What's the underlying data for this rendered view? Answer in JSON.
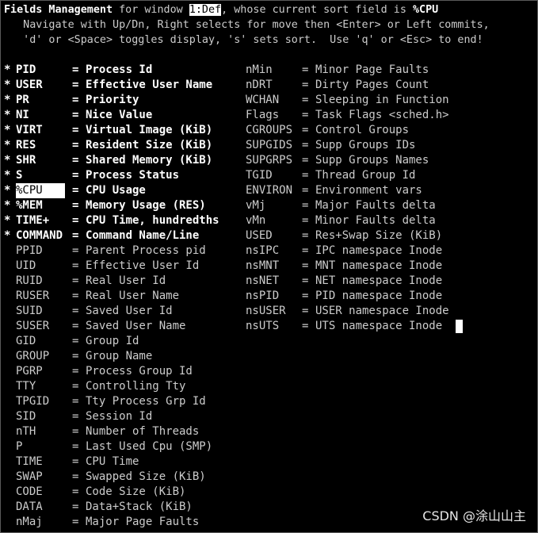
{
  "header": {
    "line1_part1": "Fields Management",
    "line1_part2": " for window ",
    "line1_window": "1:Def",
    "line1_part3": ", whose current sort field is ",
    "line1_sort": "%CPU",
    "line2": "   Navigate with Up/Dn, Right selects for move then <Enter> or Left commits,",
    "line3": "   'd' or <Space> toggles display, 's' sets sort.  Use 'q' or <Esc> to end!"
  },
  "left_fields": [
    {
      "mark": "*",
      "name": "PID",
      "eq": "=",
      "desc": "Process Id",
      "on": true
    },
    {
      "mark": "*",
      "name": "USER",
      "eq": "=",
      "desc": "Effective User Name",
      "on": true
    },
    {
      "mark": "*",
      "name": "PR",
      "eq": "=",
      "desc": "Priority",
      "on": true
    },
    {
      "mark": "*",
      "name": "NI",
      "eq": "=",
      "desc": "Nice Value",
      "on": true
    },
    {
      "mark": "*",
      "name": "VIRT",
      "eq": "=",
      "desc": "Virtual Image (KiB)",
      "on": true
    },
    {
      "mark": "*",
      "name": "RES",
      "eq": "=",
      "desc": "Resident Size (KiB)",
      "on": true
    },
    {
      "mark": "*",
      "name": "SHR",
      "eq": "=",
      "desc": "Shared Memory (KiB)",
      "on": true
    },
    {
      "mark": "*",
      "name": "S",
      "eq": "=",
      "desc": "Process Status",
      "on": true
    },
    {
      "mark": "*",
      "name": "%CPU",
      "eq": "=",
      "desc": "CPU Usage",
      "on": true,
      "selected": true
    },
    {
      "mark": "*",
      "name": "%MEM",
      "eq": "=",
      "desc": "Memory Usage (RES)",
      "on": true
    },
    {
      "mark": "*",
      "name": "TIME+",
      "eq": "=",
      "desc": "CPU Time, hundredths",
      "on": true
    },
    {
      "mark": "*",
      "name": "COMMAND",
      "eq": "=",
      "desc": "Command Name/Line",
      "on": true
    },
    {
      "mark": "",
      "name": "PPID",
      "eq": "=",
      "desc": "Parent Process pid",
      "on": false
    },
    {
      "mark": "",
      "name": "UID",
      "eq": "=",
      "desc": "Effective User Id",
      "on": false
    },
    {
      "mark": "",
      "name": "RUID",
      "eq": "=",
      "desc": "Real User Id",
      "on": false
    },
    {
      "mark": "",
      "name": "RUSER",
      "eq": "=",
      "desc": "Real User Name",
      "on": false
    },
    {
      "mark": "",
      "name": "SUID",
      "eq": "=",
      "desc": "Saved User Id",
      "on": false
    },
    {
      "mark": "",
      "name": "SUSER",
      "eq": "=",
      "desc": "Saved User Name",
      "on": false
    },
    {
      "mark": "",
      "name": "GID",
      "eq": "=",
      "desc": "Group Id",
      "on": false
    },
    {
      "mark": "",
      "name": "GROUP",
      "eq": "=",
      "desc": "Group Name",
      "on": false
    },
    {
      "mark": "",
      "name": "PGRP",
      "eq": "=",
      "desc": "Process Group Id",
      "on": false
    },
    {
      "mark": "",
      "name": "TTY",
      "eq": "=",
      "desc": "Controlling Tty",
      "on": false
    },
    {
      "mark": "",
      "name": "TPGID",
      "eq": "=",
      "desc": "Tty Process Grp Id",
      "on": false
    },
    {
      "mark": "",
      "name": "SID",
      "eq": "=",
      "desc": "Session Id",
      "on": false
    },
    {
      "mark": "",
      "name": "nTH",
      "eq": "=",
      "desc": "Number of Threads",
      "on": false
    },
    {
      "mark": "",
      "name": "P",
      "eq": "=",
      "desc": "Last Used Cpu (SMP)",
      "on": false
    },
    {
      "mark": "",
      "name": "TIME",
      "eq": "=",
      "desc": "CPU Time",
      "on": false
    },
    {
      "mark": "",
      "name": "SWAP",
      "eq": "=",
      "desc": "Swapped Size (KiB)",
      "on": false
    },
    {
      "mark": "",
      "name": "CODE",
      "eq": "=",
      "desc": "Code Size (KiB)",
      "on": false
    },
    {
      "mark": "",
      "name": "DATA",
      "eq": "=",
      "desc": "Data+Stack (KiB)",
      "on": false
    },
    {
      "mark": "",
      "name": "nMaj",
      "eq": "=",
      "desc": "Major Page Faults",
      "on": false
    }
  ],
  "right_fields": [
    {
      "name": "nMin",
      "eq": "=",
      "desc": "Minor Page Faults"
    },
    {
      "name": "nDRT",
      "eq": "=",
      "desc": "Dirty Pages Count"
    },
    {
      "name": "WCHAN",
      "eq": "=",
      "desc": "Sleeping in Function"
    },
    {
      "name": "Flags",
      "eq": "=",
      "desc": "Task Flags <sched.h>"
    },
    {
      "name": "CGROUPS",
      "eq": "=",
      "desc": "Control Groups"
    },
    {
      "name": "SUPGIDS",
      "eq": "=",
      "desc": "Supp Groups IDs"
    },
    {
      "name": "SUPGRPS",
      "eq": "=",
      "desc": "Supp Groups Names"
    },
    {
      "name": "TGID",
      "eq": "=",
      "desc": "Thread Group Id"
    },
    {
      "name": "ENVIRON",
      "eq": "=",
      "desc": "Environment vars"
    },
    {
      "name": "vMj",
      "eq": "=",
      "desc": "Major Faults delta"
    },
    {
      "name": "vMn",
      "eq": "=",
      "desc": "Minor Faults delta"
    },
    {
      "name": "USED",
      "eq": "=",
      "desc": "Res+Swap Size (KiB)"
    },
    {
      "name": "nsIPC",
      "eq": "=",
      "desc": "IPC namespace Inode"
    },
    {
      "name": "nsMNT",
      "eq": "=",
      "desc": "MNT namespace Inode"
    },
    {
      "name": "nsNET",
      "eq": "=",
      "desc": "NET namespace Inode"
    },
    {
      "name": "nsPID",
      "eq": "=",
      "desc": "PID namespace Inode"
    },
    {
      "name": "nsUSER",
      "eq": "=",
      "desc": "USER namespace Inode"
    },
    {
      "name": "nsUTS",
      "eq": "=",
      "desc": "UTS namespace Inode"
    }
  ],
  "watermark": "CSDN @涂山山主",
  "colors": {
    "background": "#000000",
    "text": "#cccccc",
    "bold": "#ffffff",
    "highlight_bg": "#ffffff"
  }
}
